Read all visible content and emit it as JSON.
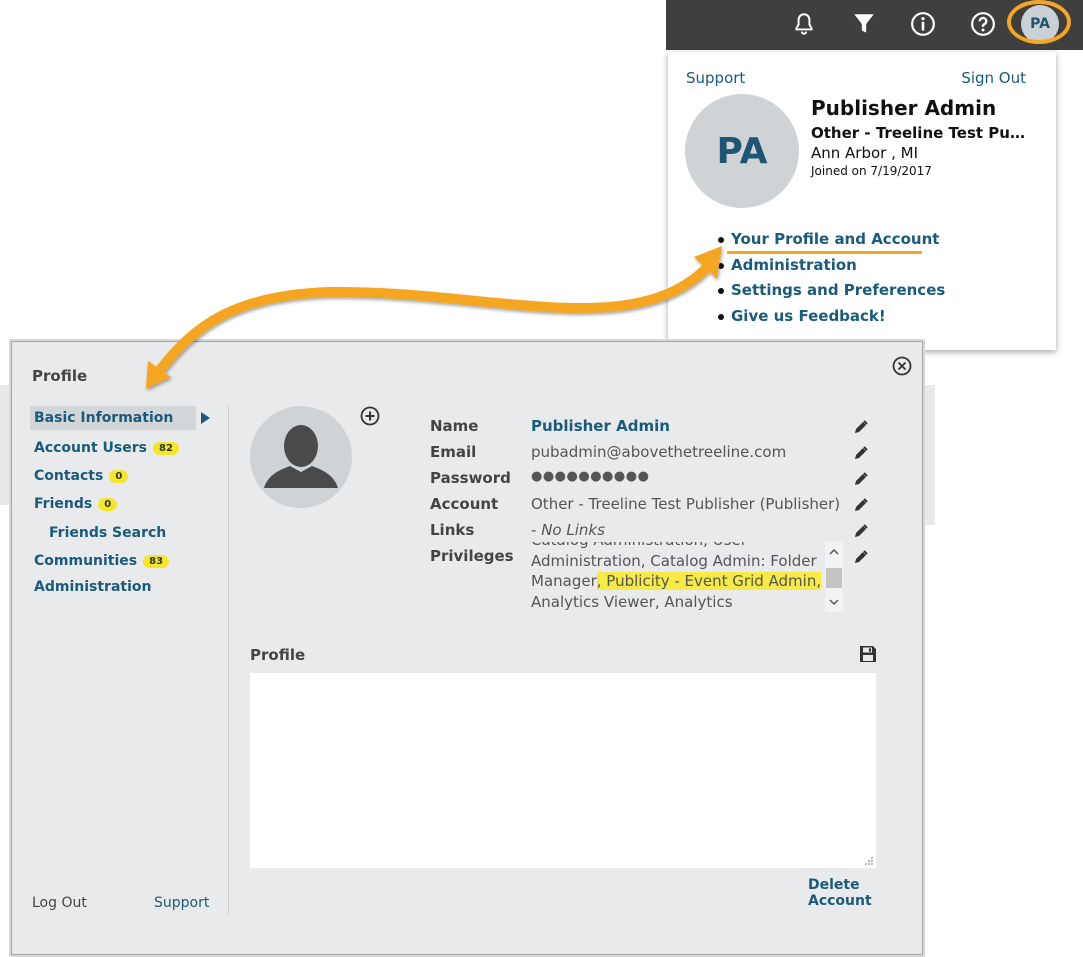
{
  "toolbar": {
    "icons": [
      "bell-icon",
      "filter-icon",
      "info-icon",
      "help-icon"
    ],
    "avatar_initials": "PA"
  },
  "dropdown": {
    "support": "Support",
    "sign_out": "Sign Out",
    "avatar_initials": "PA",
    "name": "Publisher Admin",
    "org": "Other - Treeline Test Pub...",
    "location": "Ann Arbor , MI",
    "joined": "Joined on 7/19/2017",
    "menu": [
      "Your Profile and Account",
      "Administration",
      "Settings and Preferences",
      "Give us Feedback!"
    ]
  },
  "dialog": {
    "title": "Profile",
    "nav": {
      "basic_information": "Basic Information",
      "account_users": "Account Users",
      "account_users_count": "82",
      "contacts": "Contacts",
      "contacts_count": "0",
      "friends": "Friends",
      "friends_count": "0",
      "friends_search": "Friends Search",
      "communities": "Communities",
      "communities_count": "83",
      "administration": "Administration"
    },
    "footer": {
      "log_out": "Log Out",
      "support": "Support"
    },
    "fields": {
      "name_label": "Name",
      "name_value": "Publisher Admin",
      "email_label": "Email",
      "email_value": "pubadmin@abovethetreeline.com",
      "password_label": "Password",
      "password_value": "●●●●●●●●●●",
      "account_label": "Account",
      "account_value": "Other - Treeline Test Publisher (Publisher)",
      "links_label": "Links",
      "links_value_prefix": "- ",
      "links_value": "No Links",
      "privileges_label": "Privileges",
      "privileges_lines": [
        "Catalog Administration, User",
        "Administration, Catalog Admin: Folder",
        "Manager",
        ", Publicity - Event Grid Admin,",
        "Analytics Viewer, Analytics Administrator,"
      ]
    },
    "profile_label": "Profile",
    "delete_account": "Delete Account"
  },
  "colors": {
    "accent_orange": "#f4a522",
    "link_blue": "#1a5a7a",
    "toolbar_bg": "#3f3f3f",
    "badge_yellow": "#f5e627",
    "highlight_yellow": "#f5ea46"
  }
}
